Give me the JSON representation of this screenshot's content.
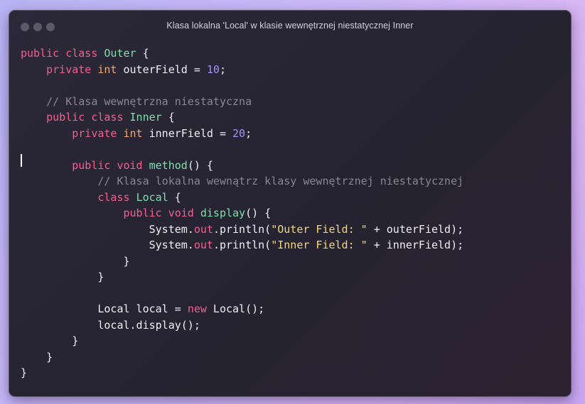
{
  "window": {
    "title": "Klasa lokalna 'Local' w klasie wewnętrznej niestatycznej Inner",
    "controls": [
      "close",
      "minimize",
      "maximize"
    ]
  },
  "colors": {
    "keyword": "#f3608e",
    "type": "#f6a86a",
    "class_name": "#7fe0a9",
    "number": "#a193f7",
    "string": "#f4d77a",
    "comment": "#8a8598",
    "text": "#f1eff7"
  },
  "code": {
    "language": "java",
    "lines": [
      [
        {
          "t": "kw",
          "v": "public"
        },
        {
          "t": "p",
          "v": " "
        },
        {
          "t": "kw",
          "v": "class"
        },
        {
          "t": "p",
          "v": " "
        },
        {
          "t": "cls",
          "v": "Outer"
        },
        {
          "t": "p",
          "v": " {"
        }
      ],
      [
        {
          "t": "p",
          "v": "    "
        },
        {
          "t": "kw",
          "v": "private"
        },
        {
          "t": "p",
          "v": " "
        },
        {
          "t": "ty",
          "v": "int"
        },
        {
          "t": "p",
          "v": " outerField = "
        },
        {
          "t": "num",
          "v": "10"
        },
        {
          "t": "p",
          "v": ";"
        }
      ],
      [],
      [
        {
          "t": "p",
          "v": "    "
        },
        {
          "t": "cm",
          "v": "// Klasa wewnętrzna niestatyczna"
        }
      ],
      [
        {
          "t": "p",
          "v": "    "
        },
        {
          "t": "kw",
          "v": "public"
        },
        {
          "t": "p",
          "v": " "
        },
        {
          "t": "kw",
          "v": "class"
        },
        {
          "t": "p",
          "v": " "
        },
        {
          "t": "cls",
          "v": "Inner"
        },
        {
          "t": "p",
          "v": " {"
        }
      ],
      [
        {
          "t": "p",
          "v": "        "
        },
        {
          "t": "kw",
          "v": "private"
        },
        {
          "t": "p",
          "v": " "
        },
        {
          "t": "ty",
          "v": "int"
        },
        {
          "t": "p",
          "v": " innerField = "
        },
        {
          "t": "num",
          "v": "20"
        },
        {
          "t": "p",
          "v": ";"
        }
      ],
      [],
      [
        {
          "t": "p",
          "v": "        "
        },
        {
          "t": "kw",
          "v": "public"
        },
        {
          "t": "p",
          "v": " "
        },
        {
          "t": "kw",
          "v": "void"
        },
        {
          "t": "p",
          "v": " "
        },
        {
          "t": "fn",
          "v": "method"
        },
        {
          "t": "p",
          "v": "() {"
        }
      ],
      [
        {
          "t": "p",
          "v": "            "
        },
        {
          "t": "cm",
          "v": "// Klasa lokalna wewnątrz klasy wewnętrznej niestatycznej"
        }
      ],
      [
        {
          "t": "p",
          "v": "            "
        },
        {
          "t": "kw",
          "v": "class"
        },
        {
          "t": "p",
          "v": " "
        },
        {
          "t": "cls",
          "v": "Local"
        },
        {
          "t": "p",
          "v": " {"
        }
      ],
      [
        {
          "t": "p",
          "v": "                "
        },
        {
          "t": "kw",
          "v": "public"
        },
        {
          "t": "p",
          "v": " "
        },
        {
          "t": "kw",
          "v": "void"
        },
        {
          "t": "p",
          "v": " "
        },
        {
          "t": "fn",
          "v": "display"
        },
        {
          "t": "p",
          "v": "() {"
        }
      ],
      [
        {
          "t": "p",
          "v": "                    System."
        },
        {
          "t": "fld",
          "v": "out"
        },
        {
          "t": "p",
          "v": ".println("
        },
        {
          "t": "str",
          "v": "\"Outer Field: \""
        },
        {
          "t": "p",
          "v": " + outerField);"
        }
      ],
      [
        {
          "t": "p",
          "v": "                    System."
        },
        {
          "t": "fld",
          "v": "out"
        },
        {
          "t": "p",
          "v": ".println("
        },
        {
          "t": "str",
          "v": "\"Inner Field: \""
        },
        {
          "t": "p",
          "v": " + innerField);"
        }
      ],
      [
        {
          "t": "p",
          "v": "                }"
        }
      ],
      [
        {
          "t": "p",
          "v": "            }"
        }
      ],
      [],
      [
        {
          "t": "p",
          "v": "            Local local = "
        },
        {
          "t": "kw",
          "v": "new"
        },
        {
          "t": "p",
          "v": " Local();"
        }
      ],
      [
        {
          "t": "p",
          "v": "            local.display();"
        }
      ],
      [
        {
          "t": "p",
          "v": "        }"
        }
      ],
      [
        {
          "t": "p",
          "v": "    }"
        }
      ],
      [
        {
          "t": "p",
          "v": "}"
        }
      ]
    ]
  }
}
